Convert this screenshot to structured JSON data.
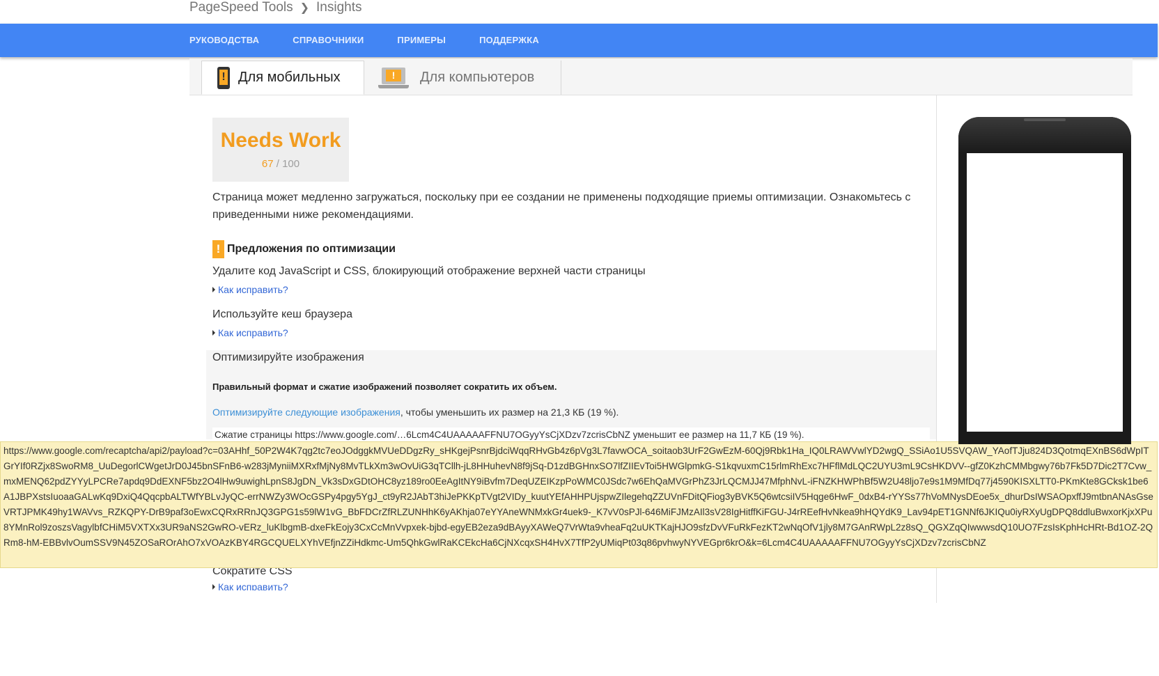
{
  "breadcrumb": {
    "root": "PageSpeed Tools",
    "current": "Insights"
  },
  "nav": {
    "items": [
      "РУКОВОДСТВА",
      "СПРАВОЧНИКИ",
      "ПРИМЕРЫ",
      "ПОДДЕРЖКА"
    ]
  },
  "tabs": {
    "mobile": "Для мобильных",
    "desktop": "Для компьютеров",
    "icon_mark": "!"
  },
  "score": {
    "label": "Needs Work",
    "value": "67",
    "max": "/ 100"
  },
  "description": "Страница может медленно загружаться, поскольку при ее создании не применены подходящие приемы оптимизации. Ознакомьтесь с приведенными ниже рекомендациями.",
  "suggestions": {
    "heading": "Предложения по оптимизации",
    "warn_icon": "!",
    "how_to_fix": "Как исправить?",
    "rules": [
      "Удалите код JavaScript и CSS, блокирующий отображение верхней части страницы",
      "Используйте кеш браузера",
      "Оптимизируйте изображения",
      "Сократите CSS"
    ]
  },
  "optimize_images": {
    "bold_text": "Правильный формат и сжатие изображений позволяет сократить их объем.",
    "link_text": "Оптимизируйте следующие изображения",
    "rest_text": ", чтобы уменьшить их размер на 21,3 КБ (19 %).",
    "compress_line": "Сжатие страницы https://www.google.com/…6Lcm4C4UAAAAAFFNU7OGyyYsCjXDzv7zcrisCbNZ уменьшит ее размер на 11,7 КБ (19 %)."
  },
  "tooltip": {
    "url": "https://www.google.com/recaptcha/api2/payload?c=03AHhf_50P2W4K7qg2tc7eoJOdggkMVUeDDgzRy_sHKgejPsnrBjdciWqqRHvGb4z6pVg3L7favwOCA_soitaob3UrF2GwEzM-60Qj9Rbk1Ha_IQ0LRAWVwlYD2wgQ_SSiAo1U5SVQAW_YAofTJju824D3QotmqEXnBS6dWpITGrYIf0RZjx8SwoRM8_UuDegorlCWgetJrD0J45bnSFnB6-w283jMyniiMXRxfMjNy8MvTLkXm3wOvUiG3qTCllh-jL8HHuhevN8f9jSq-D1zdBGHnxSO7lfZIIEvToi5HWGlpmkG-S1kqvuxmC15rlmRhExc7HFflMdLQC2UYU3mL9CsHKDVV--gfZ0KzhCMMbgwy76b7Fk5D7Dic2T7Cvw_mxMENQ62pdZYYyLPCRe7apdq9DdEXNF5bz2O4lHw9uwighLpnS8JgDN_Vk3sDxGDtOHC8yz189ro0EeAgItNY9iBvfm7DeqUZEIKzpPoWMC0JSdc7w6EhQaMVGrPhZ3JrLQCMJJ47MfphNvL-iFNZKHWPhBf5W2U48ljo7e9s1M9MfDq77j4590KISXLTT0-PKmKte8GCksk1be6A1JBPXstsIuoaaGALwKq9DxiQ4QqcpbALTWfYBLvJyQC-errNWZy3WOcGSPy4pgy5YgJ_ct9yR2JAbT3hiJePKKpTVgt2VIDy_kuutYEfAHHPUjspwZIlegehqZZUVnFDitQFiog3yBVK5Q6wtcsiIV5Hqge6HwF_0dxB4-rYYSs77hVoMNysDEoe5x_dhurDsIWSAOpxffJ9mtbnANAsGseVRTJPMK49hy1WAVvs_RZKQPY-DrB9paf3oEwxCQRxRRnJQ3GPG1s59lW1vG_BbFDCrZfRLZUNHhK6yAKhja07eYYAneWNMxkGr4uek9-_K7vV0sPJl-646MiFJMzAIl3sV28IgHitffKiFGU-J4rREefHvNkea9hHQYdK9_Lav94pET1GNNf6JKIQu0iyRXyUgDPQ8ddluBwxorKjxXPu8YMnRol9zoszsVagylbfCHiM5VXTXx3UR9aNS2GwRO-vERz_luKlbgmB-dxeFkEojy3CxCcMnVvpxek-bjbd-egyEB2eza9dBAyyXAWeQ7VrWta9vheaFq2uUKTKajHJO9sfzDvVFuRkFezKT2wNqOfV1jly8M7GAnRWpL2z8sQ_QGXZqQIwwwsdQ10UO7FzsIsKphHcHRt-Bd1OZ-2QRm8-hM-EBBvlvOumSSV9N45ZOSaROrAhO7xVOAzKBY4RGCQUELXYhVEfjnZZiHdkmc-Um5QhkGwlRaKCEkcHa6CjNXcqxSH4HvX7TfP2yUMiqPt03q86pvhwyNYVEGpr6krO&k=6Lcm4C4UAAAAAFFNU7OGyyYsCjXDzv7zcrisCbNZ"
  },
  "colors": {
    "nav_bg": "#4285f4",
    "score_orange": "#f29c1f",
    "warn_yellow": "#f9a825",
    "link_blue": "#3367d6",
    "tooltip_bg": "#fbf1c1"
  }
}
